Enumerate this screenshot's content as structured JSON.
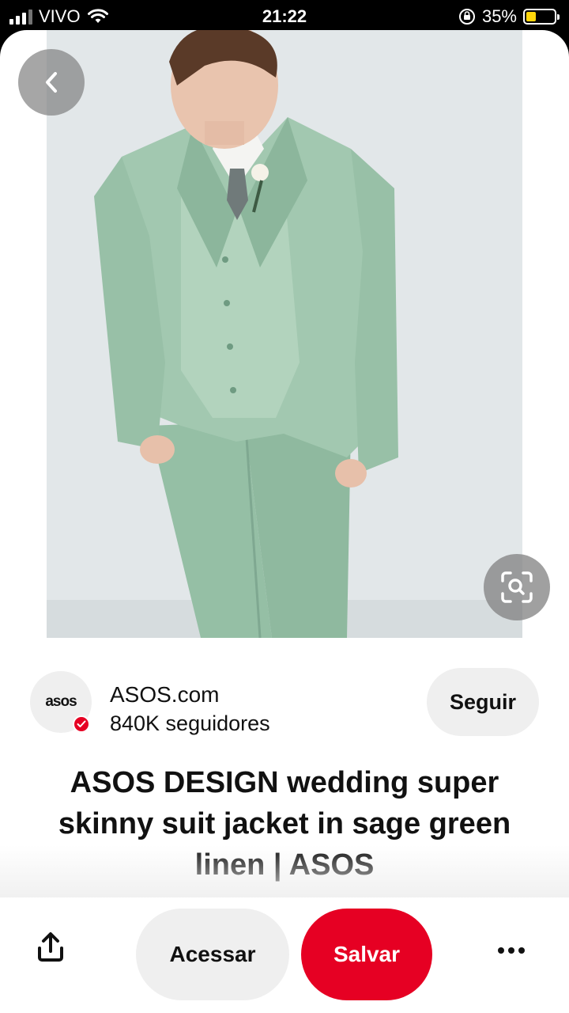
{
  "status_bar": {
    "carrier": "VIVO",
    "time": "21:22",
    "battery_percent": "35%",
    "battery_level": 0.35,
    "icons": [
      "signal-icon",
      "wifi-icon",
      "orientation-lock-icon",
      "battery-icon"
    ]
  },
  "pin": {
    "image_description_icon": "suit-photo",
    "back_icon": "chevron-left-icon",
    "lens_icon": "visual-search-icon",
    "title": "ASOS DESIGN wedding super skinny suit jacket in sage green linen | ASOS"
  },
  "profile": {
    "avatar_text": "asos",
    "name": "ASOS.com",
    "followers": "840K seguidores",
    "follow_label": "Seguir",
    "verified_color": "#e60023"
  },
  "actions": {
    "share_icon": "share-icon",
    "visit_label": "Acessar",
    "save_label": "Salvar",
    "more_icon": "more-icon",
    "save_color": "#e60023"
  }
}
